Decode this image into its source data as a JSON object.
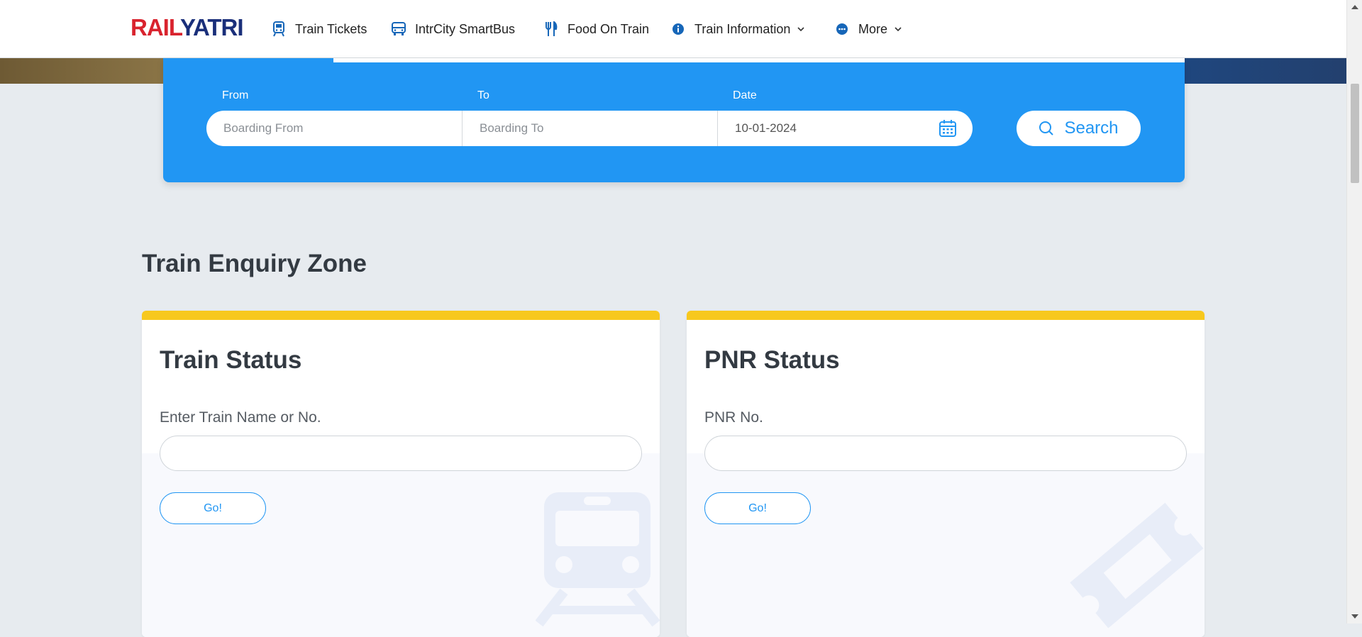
{
  "header": {
    "logo_part1": "RAIL",
    "logo_part2": "YATRI",
    "nav": [
      {
        "label": "Train Tickets",
        "icon": "train-icon"
      },
      {
        "label": "IntrCity SmartBus",
        "icon": "bus-icon"
      },
      {
        "label": "Food On Train",
        "icon": "fork-knife-icon"
      },
      {
        "label": "Train Information",
        "icon": "info-icon",
        "has_dropdown": true
      },
      {
        "label": "More",
        "icon": "more-dots-icon",
        "has_dropdown": true
      }
    ]
  },
  "search": {
    "from_label": "From",
    "to_label": "To",
    "date_label": "Date",
    "from_placeholder": "Boarding From",
    "to_placeholder": "Boarding To",
    "date_value": "10-01-2024",
    "button_label": "Search"
  },
  "enquiry": {
    "title": "Train Enquiry Zone",
    "train_status": {
      "title": "Train Status",
      "label": "Enter Train Name or No.",
      "button": "Go!"
    },
    "pnr_status": {
      "title": "PNR Status",
      "label": "PNR No.",
      "button": "Go!"
    }
  },
  "colors": {
    "brand_blue": "#2196f3",
    "accent_yellow": "#f7c81e",
    "logo_red": "#d9232e",
    "logo_navy": "#1a2f7a"
  }
}
